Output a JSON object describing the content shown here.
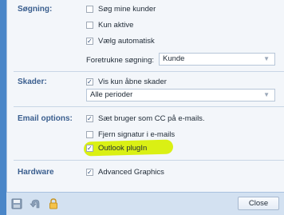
{
  "sections": {
    "sogning": {
      "label": "Søgning:",
      "checkbox_search_own": {
        "label": "Søg mine kunder",
        "checked": false
      },
      "checkbox_only_active": {
        "label": "Kun aktive",
        "checked": false
      },
      "checkbox_auto_select": {
        "label": "Vælg automatisk",
        "checked": true
      },
      "preferred_search_label": "Foretrukne søgning:",
      "preferred_search_value": "Kunde"
    },
    "skader": {
      "label": "Skader:",
      "checkbox_show_open": {
        "label": "Vis kun åbne skader",
        "checked": true
      },
      "period_value": "Alle perioder"
    },
    "email": {
      "label": "Email options:",
      "checkbox_cc": {
        "label": "Sæt bruger som CC på e-mails.",
        "checked": true
      },
      "checkbox_remove_signature": {
        "label": "Fjern signatur i e-mails",
        "checked": false
      },
      "checkbox_outlook_plugin": {
        "label": "Outlook plugIn",
        "checked": true
      }
    },
    "hardware": {
      "label": "Hardware",
      "checkbox_advanced_graphics": {
        "label": "Advanced Graphics",
        "checked": true
      }
    }
  },
  "footer": {
    "icons": [
      "save-icon",
      "undo-icon",
      "lock-icon"
    ],
    "close_label": "Close"
  },
  "colors": {
    "background_blue": "#4a86c8",
    "section_label": "#3b5f8f",
    "highlight": "#d8ef00"
  }
}
